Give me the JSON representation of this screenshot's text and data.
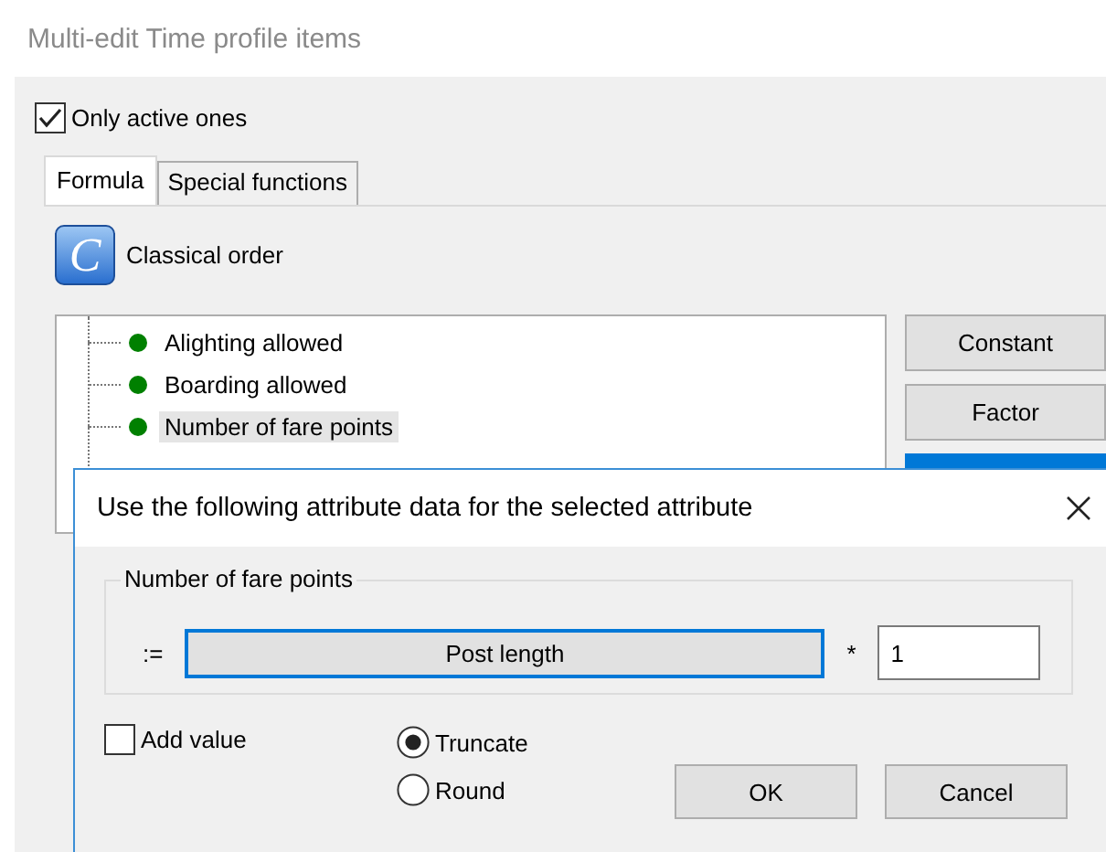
{
  "window": {
    "title": "Multi-edit Time profile items"
  },
  "only_active": {
    "label": "Only active ones",
    "checked": true
  },
  "tabs": [
    {
      "label": "Formula",
      "selected": true
    },
    {
      "label": "Special functions",
      "selected": false
    }
  ],
  "order": {
    "icon_letter": "C",
    "label": "Classical order"
  },
  "tree": [
    {
      "label": "Alighting allowed",
      "selected": false
    },
    {
      "label": "Boarding allowed",
      "selected": false
    },
    {
      "label": "Number of fare points",
      "selected": true
    }
  ],
  "buttons": [
    "Constant",
    "Factor"
  ],
  "dialog": {
    "title": "Use the following attribute data for the selected attribute",
    "group_label": "Number of fare points",
    "assign": ":=",
    "attribute_button": "Post length",
    "multiply": "*",
    "factor_value": "1",
    "add_value": {
      "label": "Add value",
      "checked": false
    },
    "rounding": [
      {
        "label": "Truncate",
        "selected": true
      },
      {
        "label": "Round",
        "selected": false
      }
    ],
    "buttons": [
      "OK",
      "Cancel"
    ]
  }
}
